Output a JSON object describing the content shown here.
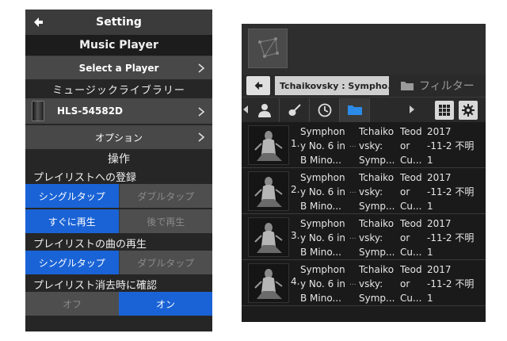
{
  "left_panel": {
    "header_title": "Setting",
    "music_player_heading": "Music Player",
    "select_player_label": "Select a Player",
    "library_heading": "ミュージックライブラリー",
    "device_name": "HLS-54582D",
    "options_label": "オプション",
    "operations_heading": "操作",
    "playlist_register": {
      "label": "プレイリストへの登録",
      "tap_options": [
        "シングルタップ",
        "ダブルタップ"
      ],
      "timing_options": [
        "すぐに再生",
        "後で再生"
      ]
    },
    "playlist_play": {
      "label": "プレイリストの曲の再生",
      "tap_options": [
        "シングルタップ",
        "ダブルタップ"
      ]
    },
    "playlist_clear_confirm": {
      "label": "プレイリスト消去時に確認",
      "options": [
        "オフ",
        "オン"
      ]
    },
    "colors": {
      "accent": "#1a63d6",
      "background": "#262626",
      "row": "#484848"
    }
  },
  "right_panel": {
    "breadcrumb": "Tchaikovsky : Sympho...",
    "filter_label": "フィルター",
    "tabs": [
      "artist-icon",
      "guitar-icon",
      "clock-icon",
      "folder-icon"
    ],
    "tracks": [
      {
        "number": "1.",
        "title": [
          "Symphon",
          "y No. 6 in",
          "B Mino..."
        ],
        "artist": [
          "Tchaiko",
          "vsky:",
          "Symp..."
        ],
        "performer": [
          "Teod",
          "or",
          "Cu..."
        ],
        "info": [
          "2017",
          "-11-2 不明",
          "1"
        ]
      },
      {
        "number": "2.",
        "title": [
          "Symphon",
          "y No. 6 in",
          "B Mino..."
        ],
        "artist": [
          "Tchaiko",
          "vsky:",
          "Symp..."
        ],
        "performer": [
          "Teod",
          "or",
          "Cu..."
        ],
        "info": [
          "2017",
          "-11-2 不明",
          "1"
        ]
      },
      {
        "number": "3.",
        "title": [
          "Symphon",
          "y No. 6 in",
          "B Mino..."
        ],
        "artist": [
          "Tchaiko",
          "vsky:",
          "Symp..."
        ],
        "performer": [
          "Teod",
          "or",
          "Cu..."
        ],
        "info": [
          "2017",
          "-11-2 不明",
          "1"
        ]
      },
      {
        "number": "4.",
        "title": [
          "Symphon",
          "y No. 6 in",
          "B Mino..."
        ],
        "artist": [
          "Tchaiko",
          "vsky:",
          "Symp..."
        ],
        "performer": [
          "Teod",
          "or",
          "Cu..."
        ],
        "info": [
          "2017",
          "-11-2 不明",
          "1"
        ]
      }
    ],
    "ellipsis": "..."
  }
}
